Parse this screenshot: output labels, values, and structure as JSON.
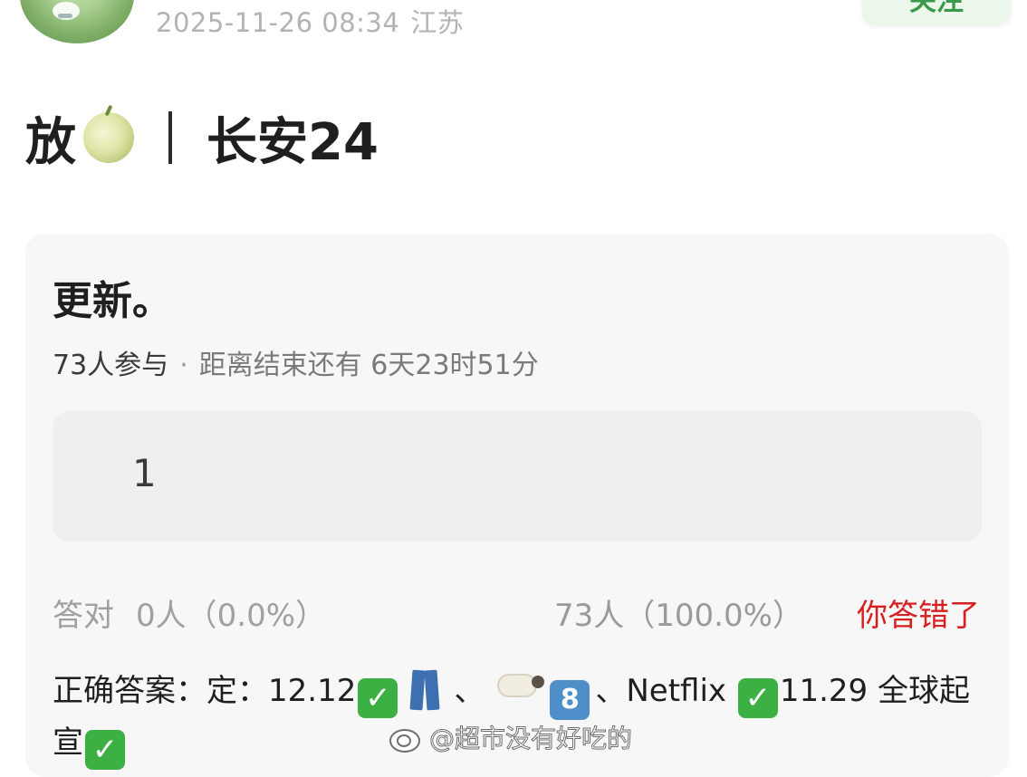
{
  "header": {
    "timestamp": "2025-11-26 08:34",
    "location": "江苏",
    "follow_label": "关注"
  },
  "post": {
    "title_prefix": "放",
    "title_icon": "melon-icon",
    "title_main": "长安24"
  },
  "vote": {
    "title": "更新。",
    "participants": "73人参与",
    "remaining": "距离结束还有 6天23时51分",
    "option_label": "1",
    "correct_label": "答对",
    "correct_count": "0人（0.0%）",
    "option_count": "73人（100.0%）",
    "wrong_status": "你答错了",
    "answer": {
      "prefix": "正确答案：定：12.12",
      "sep1": "、",
      "after_keycap": "、Netflix ",
      "keycap_digit": "8",
      "tail": "11.29 全球起宣"
    }
  },
  "watermark": {
    "icon": "weibo-icon",
    "text": "@超市没有好吃的"
  },
  "colors": {
    "accent_green": "#3cb043",
    "wrong_red": "#d81e1e",
    "card_bg": "#f7f7f7",
    "option_bg": "#efefef"
  }
}
